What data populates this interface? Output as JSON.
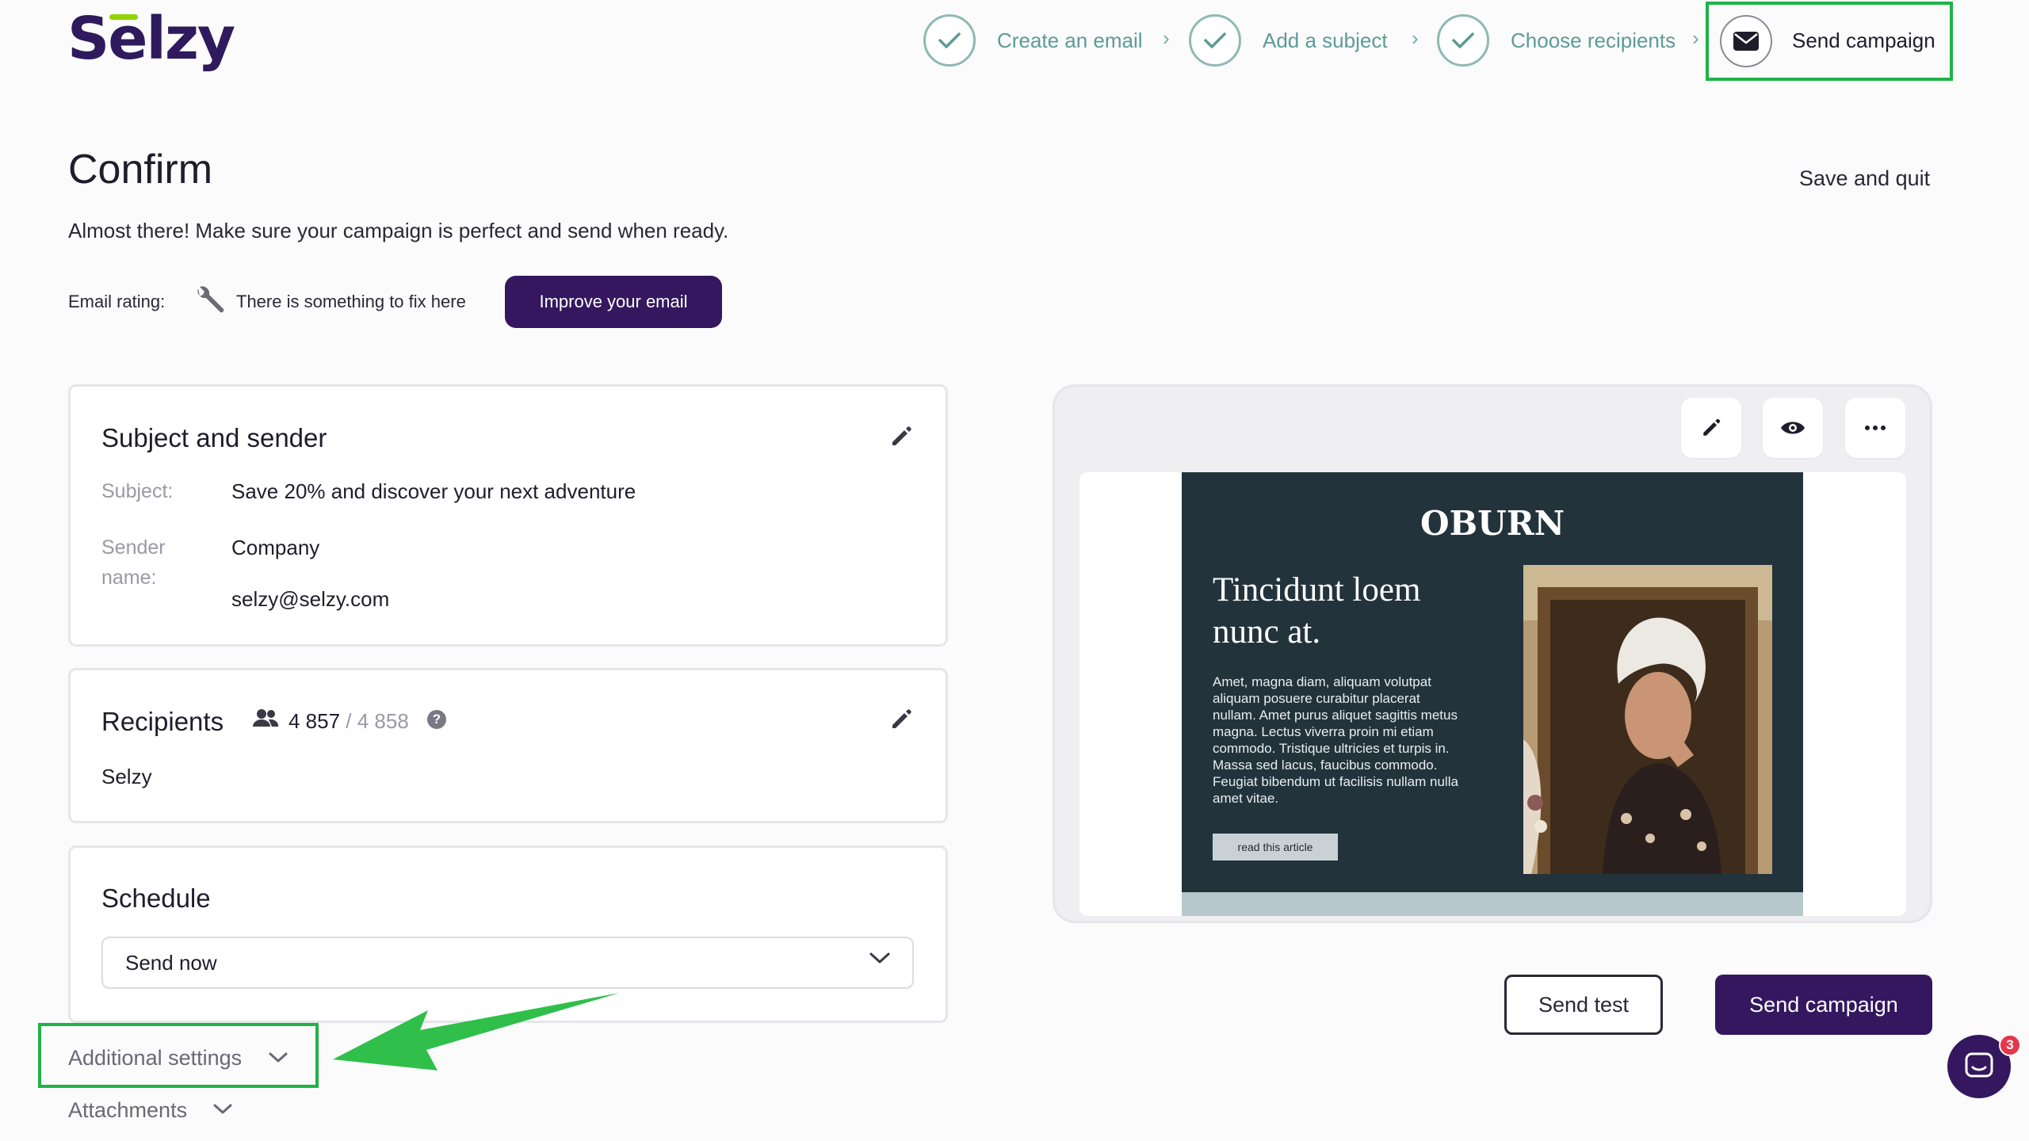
{
  "brand": {
    "logo_text": "Selzy"
  },
  "stepper": {
    "steps": [
      {
        "label": "Create an email",
        "state": "done"
      },
      {
        "label": "Add a subject",
        "state": "done"
      },
      {
        "label": "Choose recipients",
        "state": "done"
      },
      {
        "label": "Send campaign",
        "state": "active"
      }
    ],
    "chevron": "›"
  },
  "header": {
    "title": "Confirm",
    "save_quit_label": "Save and quit",
    "subtitle": "Almost there! Make sure your campaign is perfect and send when ready."
  },
  "rating": {
    "label": "Email rating:",
    "status": "There is something to fix here",
    "button_label": "Improve your email"
  },
  "subject_card": {
    "title": "Subject and sender",
    "subject_label": "Subject:",
    "subject_value": "Save 20% and discover your next adventure",
    "sender_label_line1": "Sender",
    "sender_label_line2": "name:",
    "sender_name": "Company",
    "sender_email": "selzy@selzy.com"
  },
  "recipients_card": {
    "title": "Recipients",
    "count": "4 857",
    "separator": " / ",
    "total": "4 858",
    "help_icon": "?",
    "list_name": "Selzy"
  },
  "schedule_card": {
    "title": "Schedule",
    "selected_option": "Send now"
  },
  "additional_settings_label": "Additional settings",
  "attachments_label": "Attachments",
  "preview": {
    "email_brand": "OBURN",
    "headline": "Tincidunt loem nunc at.",
    "body": "Amet, magna diam, aliquam volutpat aliquam posuere curabitur placerat nullam. Amet purus aliquet sagittis metus magna. Lectus viverra proin mi etiam commodo. Tristique ultricies et turpis in. Massa sed lacus, faucibus commodo. Feugiat bibendum ut facilisis nullam nulla amet vitae.",
    "cta": "read this article"
  },
  "actions": {
    "send_test_label": "Send test",
    "send_campaign_label": "Send campaign"
  },
  "chat": {
    "badge_count": "3"
  },
  "colors": {
    "brand_purple": "#34175e",
    "highlight_green": "#1fb347",
    "step_teal": "#5d9b95"
  }
}
